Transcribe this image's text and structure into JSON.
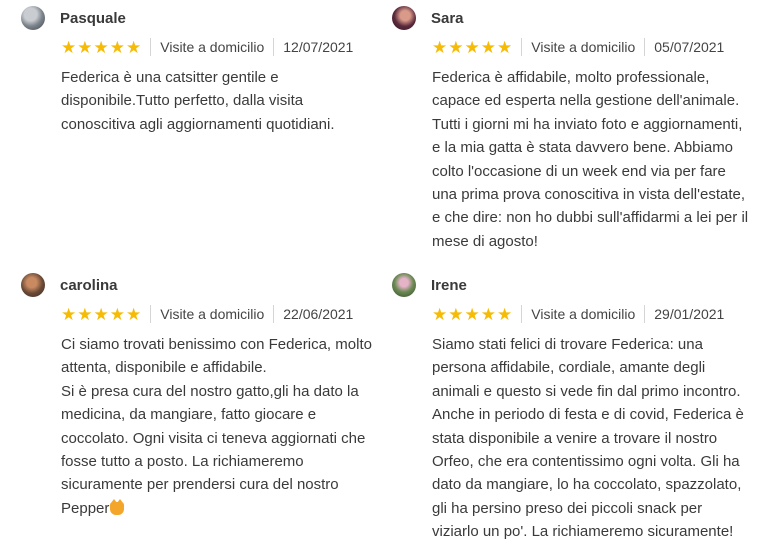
{
  "colors": {
    "star": "#f6bb06",
    "text": "#3a3a3a",
    "divider": "#d5d5d5"
  },
  "reviews": [
    {
      "name": "Pasquale",
      "rating": 5,
      "service": "Visite a domicilio",
      "date": "12/07/2021",
      "text": "Federica è una catsitter gentile e\ndisponibile.Tutto perfetto, dalla visita\nconoscitiva agli aggiornamenti quotidiani."
    },
    {
      "name": "Sara",
      "rating": 5,
      "service": "Visite a domicilio",
      "date": "05/07/2021",
      "text": "Federica è affidabile, molto professionale,\ncapace ed esperta nella gestione dell'animale.\nTutti i giorni mi ha inviato foto e aggiornamenti,\ne la mia gatta è stata davvero bene. Abbiamo\ncolto l'occasione di un week end via per fare\nuna prima prova conoscitiva in vista dell'estate,\ne che dire: non ho dubbi sull'affidarmi a lei per il\nmese di agosto!"
    },
    {
      "name": "carolina",
      "rating": 5,
      "service": "Visite a domicilio",
      "date": "22/06/2021",
      "text": "Ci siamo trovati benissimo con Federica, molto\nattenta, disponibile e affidabile.\nSi è presa cura del nostro gatto,gli ha dato la\nmedicina, da mangiare, fatto giocare e\ncoccolato. Ogni visita ci teneva aggiornati che\nfosse tutto a posto. La richiameremo\nsicuramente per prendersi cura del nostro\nPepper",
      "emoji": "cat-face-icon"
    },
    {
      "name": "Irene",
      "rating": 5,
      "service": "Visite a domicilio",
      "date": "29/01/2021",
      "text": "Siamo stati felici di trovare Federica: una\npersona affidabile, cordiale, amante degli\nanimali e questo si vede fin dal primo incontro.\nAnche in periodo di festa e di covid, Federica è\nstata disponibile a venire a trovare il nostro\nOrfeo, che era contentissimo ogni volta. Gli ha\ndato da mangiare, lo ha coccolato, spazzolato,\ngli ha persino preso dei piccoli snack per\nviziarlo un po'. La richiameremo sicuramente!"
    }
  ]
}
